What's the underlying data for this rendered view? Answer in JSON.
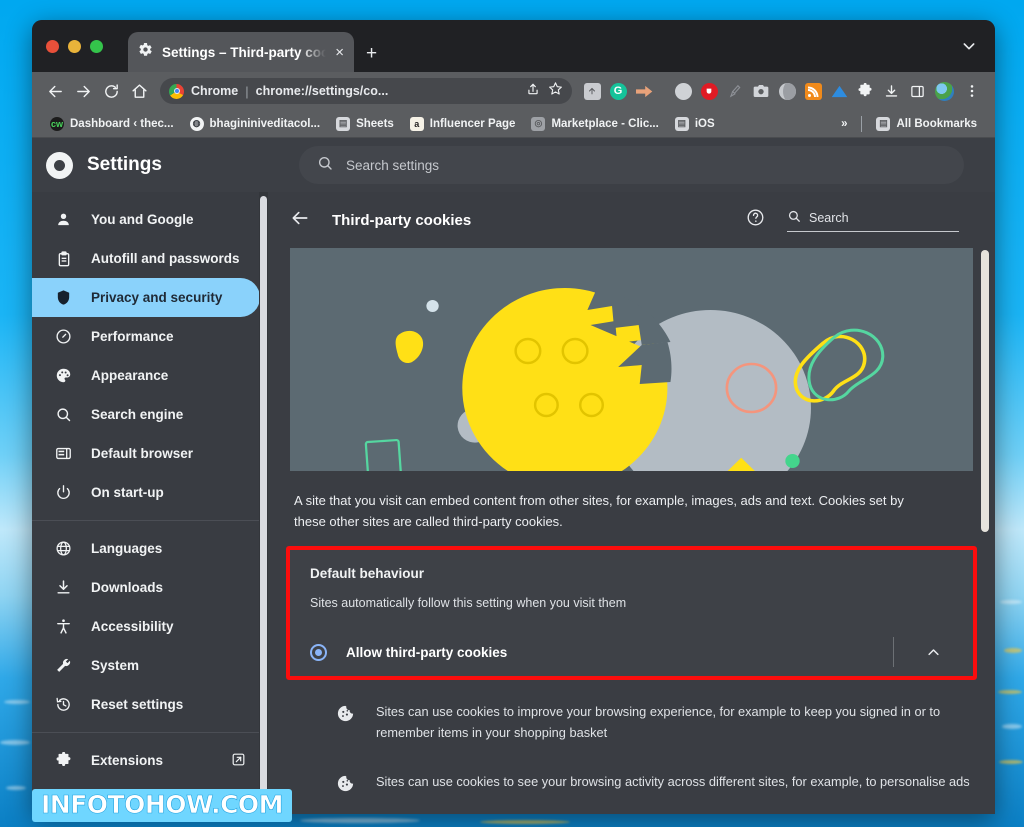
{
  "window": {
    "tab": {
      "title": "Settings – Third-party cookies",
      "icon": "gear-icon",
      "close": "×"
    },
    "new_tab_label": "+",
    "chevron": "⌄"
  },
  "toolbar": {
    "back": "←",
    "forward": "→",
    "reload": "↻",
    "home": "⌂",
    "omnibox": {
      "site_label": "Chrome",
      "separator": "|",
      "url": "chrome://settings/co...",
      "share": "⇪",
      "bookmark_star": "☆"
    },
    "extensions": [
      {
        "name": "extension-icon-screenshot",
        "color": "#c9cbcf"
      },
      {
        "name": "extension-icon-grammarly",
        "color": "#15c39a"
      },
      {
        "name": "extension-icon-arrow",
        "color": "#e8a27a"
      },
      {
        "name": "extension-icon-circle-grey",
        "color": "#cfd2d6"
      },
      {
        "name": "extension-icon-pocket",
        "color": "#e01b24"
      },
      {
        "name": "extension-icon-ruler",
        "color": "#8d9096"
      },
      {
        "name": "extension-icon-camera",
        "color": "#d2d5d9"
      },
      {
        "name": "extension-icon-moon",
        "color": "#c6c9cd"
      },
      {
        "name": "extension-icon-rss",
        "color": "#f08a1b"
      },
      {
        "name": "extension-icon-triangle",
        "color": "#2d8ce0"
      },
      {
        "name": "extension-icon-puzzle",
        "color": "#f1f3f4"
      },
      {
        "name": "extension-icon-download",
        "color": "#f1f3f4"
      },
      {
        "name": "extension-icon-sidepanel",
        "color": "#f1f3f4"
      },
      {
        "name": "profile-avatar",
        "color": "#4b9b4b"
      },
      {
        "name": "chrome-menu-icon",
        "color": "#f1f3f4"
      }
    ]
  },
  "bookmarks": {
    "items": [
      {
        "label": "Dashboard ‹ thec...",
        "fav": "cw",
        "fav_bg": "#1b1b1b",
        "fav_fg": "#49d45c"
      },
      {
        "label": "bhagininiveditacol...",
        "fav": "◍",
        "fav_bg": "#f1f3f4",
        "fav_fg": "#3a3d43"
      },
      {
        "label": "Sheets",
        "fav": "▤",
        "fav_bg": "#d6d8dc",
        "fav_fg": "#5b5d60"
      },
      {
        "label": "Influencer Page",
        "fav": "a",
        "fav_bg": "#f6f2e7",
        "fav_fg": "#221f1f"
      },
      {
        "label": "Marketplace - Clic...",
        "fav": "◎",
        "fav_bg": "#9ea1a6",
        "fav_fg": "#5b5d60"
      },
      {
        "label": "iOS",
        "fav": "▤",
        "fav_bg": "#d6d8dc",
        "fav_fg": "#5b5d60"
      }
    ],
    "overflow": "»",
    "all_bookmarks": {
      "label": "All Bookmarks",
      "fav": "▤"
    }
  },
  "settings": {
    "logo": "chrome-logo-icon",
    "title": "Settings",
    "search": {
      "placeholder": "Search settings",
      "icon": "search-icon"
    }
  },
  "sidebar": {
    "items": [
      {
        "label": "You and Google",
        "icon": "person-icon",
        "active": false
      },
      {
        "label": "Autofill and passwords",
        "icon": "clipboard-icon",
        "active": false
      },
      {
        "label": "Privacy and security",
        "icon": "shield-icon",
        "active": true
      },
      {
        "label": "Performance",
        "icon": "gauge-icon",
        "active": false
      },
      {
        "label": "Appearance",
        "icon": "palette-icon",
        "active": false
      },
      {
        "label": "Search engine",
        "icon": "search-icon",
        "active": false
      },
      {
        "label": "Default browser",
        "icon": "browser-window-icon",
        "active": false
      },
      {
        "label": "On start-up",
        "icon": "power-icon",
        "active": false
      }
    ],
    "group2": [
      {
        "label": "Languages",
        "icon": "globe-icon"
      },
      {
        "label": "Downloads",
        "icon": "download-icon"
      },
      {
        "label": "Accessibility",
        "icon": "accessibility-icon"
      },
      {
        "label": "System",
        "icon": "wrench-icon"
      },
      {
        "label": "Reset settings",
        "icon": "history-restore-icon"
      }
    ],
    "group3": [
      {
        "label": "Extensions",
        "icon": "puzzle-icon",
        "external": "↗"
      }
    ]
  },
  "main": {
    "back_icon": "back-arrow-icon",
    "title": "Third-party cookies",
    "help_icon": "help-circle-icon",
    "search": {
      "placeholder": "Search",
      "icon": "search-icon"
    },
    "banner_alt": "cookie-illustration",
    "description": "A site that you visit can embed content from other sites, for example, images, ads and text. Cookies set by these other sites are called third-party cookies.",
    "default_behaviour": {
      "title": "Default behaviour",
      "subtitle": "Sites automatically follow this setting when you visit them",
      "option_label": "Allow third-party cookies",
      "option_selected": true,
      "expand_icon": "chevron-up-icon"
    },
    "bullets": [
      {
        "icon": "cookie-icon",
        "text": "Sites can use cookies to improve your browsing experience, for example to keep you signed in or to remember items in your shopping basket"
      },
      {
        "icon": "cookie-icon",
        "text": "Sites can use cookies to see your browsing activity across different sites, for example, to personalise ads"
      }
    ]
  },
  "watermark": {
    "text": "INFOTOHOW.COM"
  },
  "colors": {
    "highlight_red": "#fb0d0d",
    "active_nav": "#8ad2fb",
    "radio_blue": "#8ab4f8",
    "cookie_yellow": "#ffe016"
  }
}
